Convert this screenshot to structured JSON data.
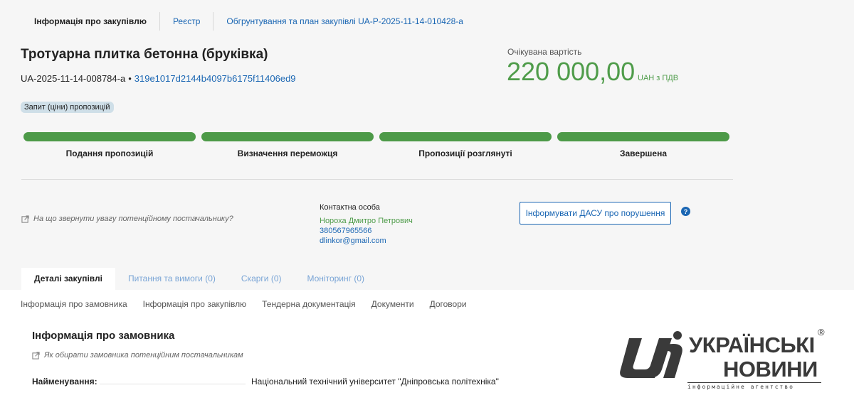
{
  "breadcrumbs": [
    "Інформація про закупівлю",
    "Реєстр",
    "Обгрунтування та план закупівлі UA-P-2025-11-14-010428-a"
  ],
  "tender": {
    "title": "Тротуарна плитка бетонна (бруківка)",
    "id": "UA-2025-11-14-008784-a",
    "separator": "•",
    "hash": "319e1017d2144b4097b6175f11406ed9",
    "procedure": "Запит (ціни) пропозицій"
  },
  "cost": {
    "label": "Очікувана вартість",
    "value": "220 000,00",
    "unit": "UAH з ПДВ"
  },
  "stages": [
    {
      "label": "Подання пропозицій",
      "color": "#4d9a48"
    },
    {
      "label": "Визначення переможця",
      "color": "#4d9a48"
    },
    {
      "label": "Пропозиції розглянуті",
      "color": "#4d9a48"
    },
    {
      "label": "Завершена",
      "color": "#4d9a48"
    }
  ],
  "supplier_hint": "На що звернути увагу потенційному постачальнику?",
  "contact": {
    "label": "Контактна особа",
    "name": "Нороха Дмитро Петрович",
    "phone": "380567965566",
    "email": "dlinkor@gmail.com"
  },
  "dasu_button": "Інформувати ДАСУ про порушення",
  "help_icon_glyph": "?",
  "tabs": [
    "Деталі закупівлі",
    "Питання та вимоги (0)",
    "Скарги (0)",
    "Моніторинг (0)"
  ],
  "subnav": [
    "Інформація про замовника",
    "Інформація про закупівлю",
    "Тендерна документація",
    "Документи",
    "Договори"
  ],
  "customer": {
    "title": "Інформація про замовника",
    "hint": "Як обирати замовника потенційним постачальникам",
    "name_label": "Найменування:",
    "name_value": "Національний технічний університет \"Дніпровська політехніка\""
  },
  "logo": {
    "line1": "УКРАЇНСЬКІ",
    "line2": "НОВИНИ",
    "reg": "®",
    "sub": "інформаційне агентство"
  },
  "colors": {
    "accent_blue": "#1a66b3",
    "green": "#4f9c4a"
  }
}
